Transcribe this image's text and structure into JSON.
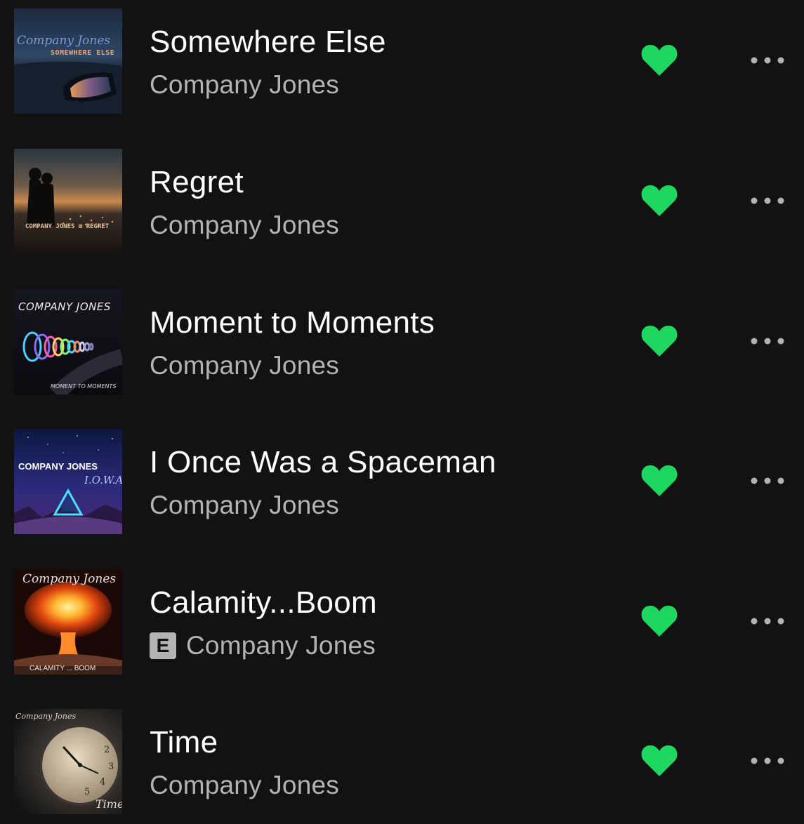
{
  "colors": {
    "background": "#121212",
    "title": "#ffffff",
    "artist": "#b3b3b3",
    "liked_heart": "#1ed760",
    "more_dots": "#b3b3b3"
  },
  "tracks": [
    {
      "title": "Somewhere Else",
      "artist": "Company Jones",
      "explicit": false,
      "liked": true,
      "cover": {
        "line1": "Company Jones",
        "line2": "SOMEWHERE ELSE"
      }
    },
    {
      "title": "Regret",
      "artist": "Company Jones",
      "explicit": false,
      "liked": true,
      "cover": {
        "line1": "COMPANY JONES ⊠ REGRET"
      }
    },
    {
      "title": "Moment to Moments",
      "artist": "Company Jones",
      "explicit": false,
      "liked": true,
      "cover": {
        "line1": "COMPANY JONES",
        "line2": "MOMENT TO MOMENTS"
      }
    },
    {
      "title": "I Once Was a Spaceman",
      "artist": "Company Jones",
      "explicit": false,
      "liked": true,
      "cover": {
        "line1": "COMPANY JONES",
        "line2": "I.O.W.A.S."
      }
    },
    {
      "title": "Calamity...Boom",
      "artist": "Company Jones",
      "explicit": true,
      "explicit_label": "E",
      "liked": true,
      "cover": {
        "line1": "Company Jones",
        "line2": "CALAMITY ... BOOM"
      }
    },
    {
      "title": "Time",
      "artist": "Company Jones",
      "explicit": false,
      "liked": true,
      "cover": {
        "line1": "Company Jones",
        "line2": "Time"
      }
    }
  ]
}
